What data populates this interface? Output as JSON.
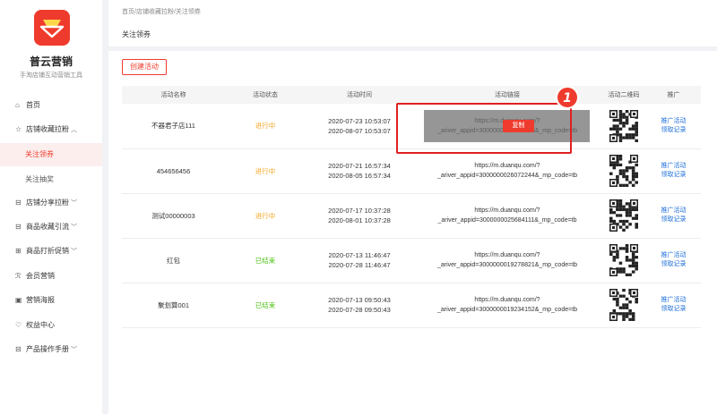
{
  "sidebar": {
    "brand": "普云营销",
    "brand_sub": "手淘店铺互动营销工具",
    "items": [
      {
        "label": "首页",
        "icon": "home-icon"
      },
      {
        "label": "店铺收藏拉粉",
        "icon": "star-icon",
        "chevron": "^"
      },
      {
        "label": "关注领券",
        "sub": true,
        "active": true
      },
      {
        "label": "关注抽奖",
        "sub": true
      },
      {
        "label": "店铺分享拉粉",
        "icon": "share-icon",
        "chevron": "v"
      },
      {
        "label": "商品收藏引流",
        "icon": "bag-icon",
        "chevron": "v"
      },
      {
        "label": "商品打折促销",
        "icon": "discount-icon",
        "chevron": "v"
      },
      {
        "label": "会员营销",
        "icon": "member-icon"
      },
      {
        "label": "营销海报",
        "icon": "poster-icon"
      },
      {
        "label": "权益中心",
        "icon": "rights-icon"
      },
      {
        "label": "产品操作手册",
        "icon": "manual-icon",
        "chevron": "v"
      }
    ]
  },
  "header": {
    "breadcrumb": "首页/店铺收藏拉粉/关注领券",
    "title": "关注领券"
  },
  "main": {
    "create_label": "创建活动",
    "columns": [
      "活动名称",
      "活动状态",
      "活动时间",
      "活动链接",
      "活动二维码",
      "推广"
    ],
    "rows": [
      {
        "name": "不器君子店111",
        "status": "进行中",
        "status_type": "running",
        "start": "2020-07-23 10:53:07",
        "end": "2020-08-07 10:53:07",
        "link1": "https://m.duanqu.com/?",
        "link2": "_ariver_appid=3000000025772243&_mp_code=tb"
      },
      {
        "name": "454656456",
        "status": "进行中",
        "status_type": "running",
        "start": "2020-07-21 16:57:34",
        "end": "2020-08-05 16:57:34",
        "link1": "https://m.duanqu.com/?",
        "link2": "_ariver_appid=3000000026072244&_mp_code=tb"
      },
      {
        "name": "测试00000003",
        "status": "进行中",
        "status_type": "running",
        "start": "2020-07-17 10:37:28",
        "end": "2020-08-01 10:37:28",
        "link1": "https://m.duanqu.com/?",
        "link2": "_ariver_appid=3000000025684111&_mp_code=tb"
      },
      {
        "name": "红包",
        "status": "已结束",
        "status_type": "ended",
        "start": "2020-07-13 11:46:47",
        "end": "2020-07-28 11:46:47",
        "link1": "https://m.duanqu.com/?",
        "link2": "_ariver_appid=3000000019278821&_mp_code=tb"
      },
      {
        "name": "聚划算001",
        "status": "已结束",
        "status_type": "ended",
        "start": "2020-07-13 09:50:43",
        "end": "2020-07-28 09:50:43",
        "link1": "https://m.duanqu.com/?",
        "link2": "_ariver_appid=3000000019234152&_mp_code=tb"
      }
    ],
    "promo_link": "推广活动",
    "records_link": "领取记录",
    "copy_label": "复制",
    "step_badge": "1"
  },
  "colors": {
    "accent": "#ef3b2d",
    "running": "#f5a623",
    "ended": "#52c41a",
    "link": "#1e6fd9"
  }
}
